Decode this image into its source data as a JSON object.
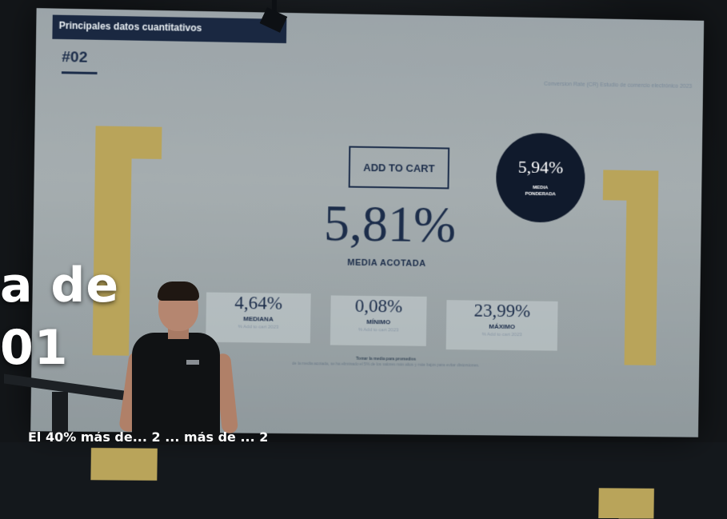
{
  "slide": {
    "header": "Principales datos cuantitativos",
    "number": "#02",
    "source": "Conversion Rate (CR) Estudio de comercio electrónico 2023",
    "cta_box": "ADD TO CART",
    "main_value": "5,81%",
    "main_label": "MEDIA ACOTADA",
    "weighted": {
      "value": "5,94%",
      "label_line1": "MEDIA",
      "label_line2": "PONDERADA"
    },
    "stats": [
      {
        "value": "4,64%",
        "label": "MEDIANA",
        "sub": "% Add to cart 2023"
      },
      {
        "value": "0,08%",
        "label": "MÍNIMO",
        "sub": "% Add to cart 2023"
      },
      {
        "value": "23,99%",
        "label": "MÁXIMO",
        "sub": "% Add to cart 2023"
      }
    ],
    "note_bold": "Tomar la media para promedios",
    "note_text": "de la media acotada, se ha eliminado el 5% de los valores más altos y más bajos para evitar distorsiones."
  },
  "overlay": {
    "line1": "a de",
    "line2": "01",
    "bottom": "El 40% más de... 2 ... más de ... 2"
  },
  "colors": {
    "navy": "#1c2d4a",
    "gold": "#b9a45a",
    "circle": "#101a2c"
  }
}
